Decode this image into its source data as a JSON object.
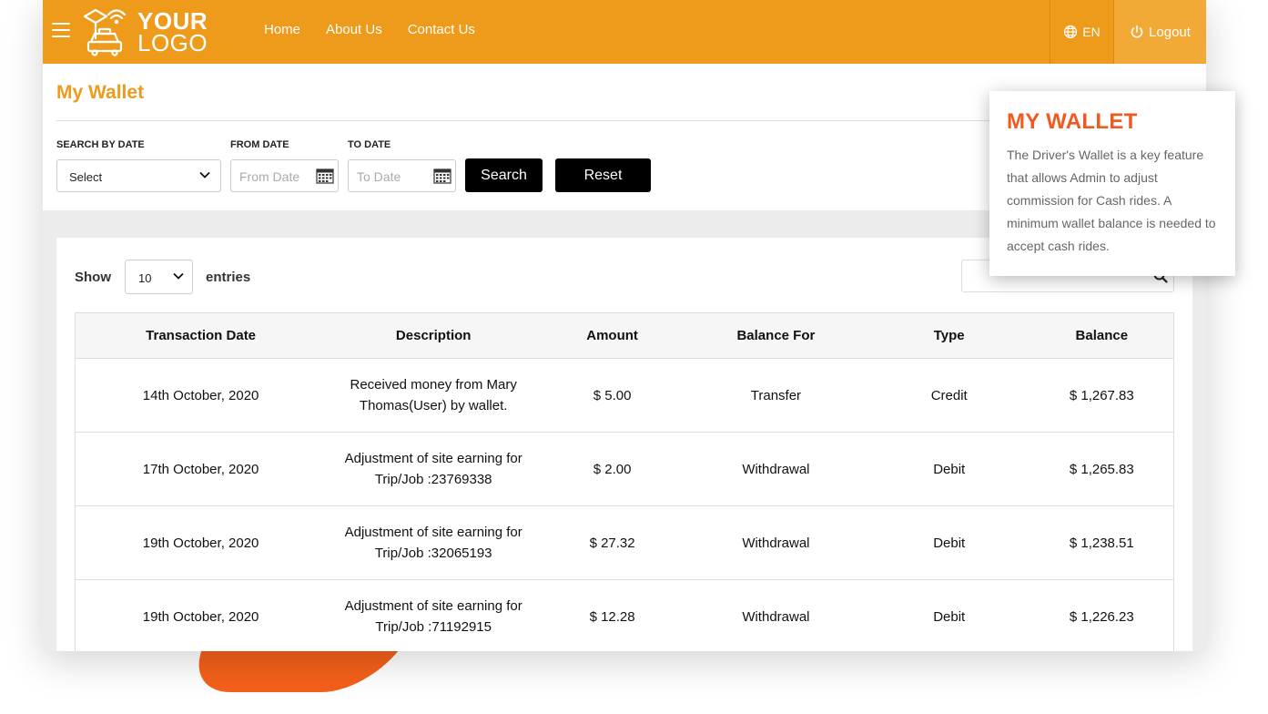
{
  "header": {
    "logo_line1": "YOUR",
    "logo_line2": "LOGO",
    "nav": [
      "Home",
      "About Us",
      "Contact Us"
    ],
    "language": "EN",
    "logout": "Logout"
  },
  "page": {
    "title": "My Wallet"
  },
  "filters": {
    "search_by_date_label": "SEARCH BY DATE",
    "search_by_date_value": "Select",
    "from_date_label": "FROM DATE",
    "from_date_placeholder": "From Date",
    "to_date_label": "TO DATE",
    "to_date_placeholder": "To Date",
    "search_button": "Search",
    "reset_button": "Reset"
  },
  "table_controls": {
    "show_label": "Show",
    "entries_value": "10",
    "entries_label": "entries"
  },
  "table": {
    "headers": [
      "Transaction Date",
      "Description",
      "Amount",
      "Balance For",
      "Type",
      "Balance"
    ],
    "rows": [
      {
        "date": "14th October, 2020",
        "description": "Received money from Mary Thomas(User) by wallet.",
        "amount": "$ 5.00",
        "balance_for": "Transfer",
        "type": "Credit",
        "balance": "$ 1,267.83"
      },
      {
        "date": "17th October, 2020",
        "description": "Adjustment of site earning for Trip/Job :23769338",
        "amount": "$ 2.00",
        "balance_for": "Withdrawal",
        "type": "Debit",
        "balance": "$ 1,265.83"
      },
      {
        "date": "19th October, 2020",
        "description": "Adjustment of site earning for Trip/Job :32065193",
        "amount": "$ 27.32",
        "balance_for": "Withdrawal",
        "type": "Debit",
        "balance": "$ 1,238.51"
      },
      {
        "date": "19th October, 2020",
        "description": "Adjustment of site earning for Trip/Job :71192915",
        "amount": "$ 12.28",
        "balance_for": "Withdrawal",
        "type": "Debit",
        "balance": "$ 1,226.23"
      }
    ]
  },
  "tooltip": {
    "title": "MY WALLET",
    "body": "The Driver's Wallet is a key feature that allows Admin to adjust commission for Cash rides. A minimum wallet balance is needed to accept cash rides."
  },
  "colors": {
    "brand_orange": "#ee9a1a",
    "accent_red_orange": "#f05a1e",
    "button_black": "#000000"
  },
  "icons": [
    "hamburger-icon",
    "taxi-logo-icon",
    "globe-icon",
    "power-icon",
    "chevron-down-icon",
    "calendar-icon",
    "search-icon"
  ]
}
